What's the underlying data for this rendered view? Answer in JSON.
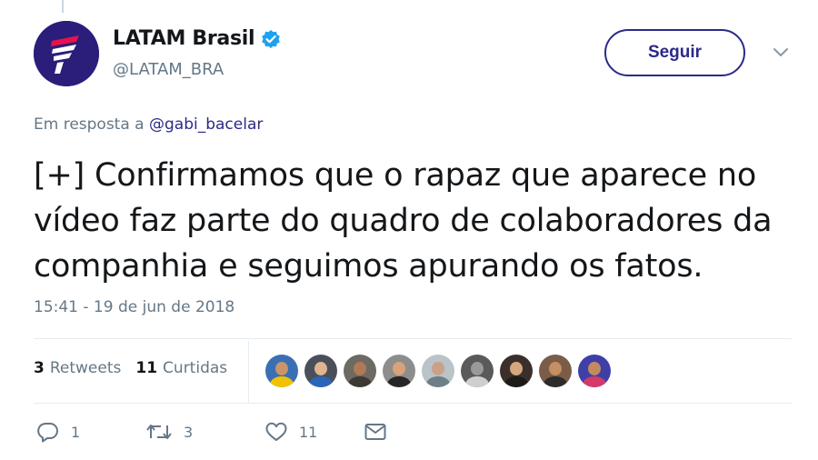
{
  "author": {
    "display_name": "LATAM Brasil",
    "handle": "@LATAM_BRA",
    "verified": true
  },
  "header": {
    "follow_label": "Seguir"
  },
  "reply": {
    "prefix": "Em resposta a ",
    "mention": "@gabi_bacelar"
  },
  "tweet": {
    "text": "[+] Confirmamos que o rapaz que aparece no vídeo faz parte do quadro de colaboradores da companhia e seguimos apurando os fatos.",
    "timestamp": "15:41 - 19 de jun de 2018"
  },
  "stats": {
    "retweets_count": "3",
    "retweets_label": "Retweets",
    "likes_count": "11",
    "likes_label": "Curtidas"
  },
  "actions": {
    "reply_count": "1",
    "retweet_count": "3",
    "like_count": "11"
  },
  "icons": {
    "verified": "verified-badge-icon",
    "caret": "chevron-down-icon",
    "reply": "reply-icon",
    "retweet": "retweet-icon",
    "like": "heart-icon",
    "dm": "envelope-icon"
  },
  "colors": {
    "brand": "#2b2a87",
    "logo_pink": "#e8114b",
    "verified": "#1da1f2",
    "secondary_text": "#657786"
  }
}
